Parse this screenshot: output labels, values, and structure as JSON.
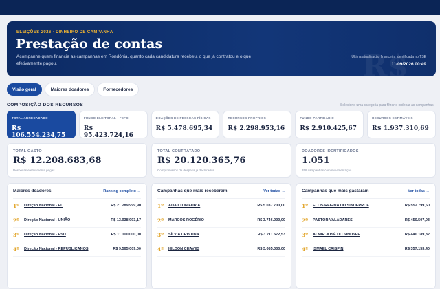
{
  "hero": {
    "eyebrow": "ELEIÇÕES 2026 · DINHEIRO DE CAMPANHA",
    "title": "Prestação de contas",
    "description": "Acompanhe quem financia as campanhas em Rondônia, quanto cada candidatura recebeu, o que já contratou e o que efetivamente pagou.",
    "watermark": "R$",
    "update_label": "Última atualização financeira identificada no TSE",
    "update_value": "11/09/2026 00:49"
  },
  "tabs": [
    {
      "label": "Visão geral",
      "active": true
    },
    {
      "label": "Maiores doadores",
      "active": false
    },
    {
      "label": "Fornecedores",
      "active": false
    }
  ],
  "composition": {
    "title": "COMPOSIÇÃO DOS RECURSOS",
    "hint": "Selecione uma categoria para filtrar e ordenar as campanhas.",
    "cards": [
      {
        "label": "TOTAL ARRECADADO",
        "value": "R$ 106.554.234,75",
        "active": true
      },
      {
        "label": "FUNDO ELEITORAL · FEFC",
        "value": "R$ 95.423.724,16",
        "active": false
      },
      {
        "label": "DOAÇÕES DE PESSOAS FÍSICAS",
        "value": "R$ 5.478.695,34",
        "active": false
      },
      {
        "label": "RECURSOS PRÓPRIOS",
        "value": "R$ 2.298.953,16",
        "active": false
      },
      {
        "label": "FUNDO PARTIDÁRIO",
        "value": "R$ 2.910.425,67",
        "active": false
      },
      {
        "label": "RECURSOS ESTIMÁVEIS",
        "value": "R$ 1.937.310,69",
        "active": false
      }
    ]
  },
  "totals": [
    {
      "label": "TOTAL GASTO",
      "value": "R$ 12.208.683,68",
      "sub": "Despesas efetivamente pagas"
    },
    {
      "label": "TOTAL CONTRATADO",
      "value": "R$ 20.120.365,76",
      "sub": "Compromissos de despesa já declarados"
    },
    {
      "label": "DOADORES IDENTIFICADOS",
      "value": "1.051",
      "sub": "358 campanhas com movimentação"
    }
  ],
  "panels": [
    {
      "title": "Maiores doadores",
      "link": "Ranking completo →",
      "rows": [
        {
          "rank": "1º",
          "name": "Direção Nacional - PL",
          "amount": "R$ 21.289.999,90"
        },
        {
          "rank": "2º",
          "name": "Direção Nacional - UNIÃO",
          "amount": "R$ 13.938.993,17"
        },
        {
          "rank": "3º",
          "name": "Direção Nacional - PSD",
          "amount": "R$ 11.100.000,00"
        },
        {
          "rank": "4º",
          "name": "Direção Nacional - REPUBLICANOS",
          "amount": "R$ 9.565.009,00"
        }
      ]
    },
    {
      "title": "Campanhas que mais receberam",
      "link": "Ver todas →",
      "rows": [
        {
          "rank": "1º",
          "name": "ADAILTON FURIA",
          "amount": "R$ 5.037.700,00"
        },
        {
          "rank": "2º",
          "name": "MARCOS ROGÉRIO",
          "amount": "R$ 3.746.000,00"
        },
        {
          "rank": "3º",
          "name": "SÍLVIA CRISTINA",
          "amount": "R$ 3.211.572,53"
        },
        {
          "rank": "4º",
          "name": "HILDON CHAVES",
          "amount": "R$ 3.085.000,00"
        }
      ]
    },
    {
      "title": "Campanhas que mais gastaram",
      "link": "Ver todas →",
      "rows": [
        {
          "rank": "1º",
          "name": "ELLIS REGINA DO SINDEPROF",
          "amount": "R$ 552.799,50"
        },
        {
          "rank": "2º",
          "name": "PASTOR VALADARES",
          "amount": "R$ 450.507,03"
        },
        {
          "rank": "3º",
          "name": "ALMIR JOSÉ DO SINDSEF",
          "amount": "R$ 440.189,32"
        },
        {
          "rank": "4º",
          "name": "ISMAEL CRISPIN",
          "amount": "R$ 357.153,40"
        }
      ]
    }
  ]
}
